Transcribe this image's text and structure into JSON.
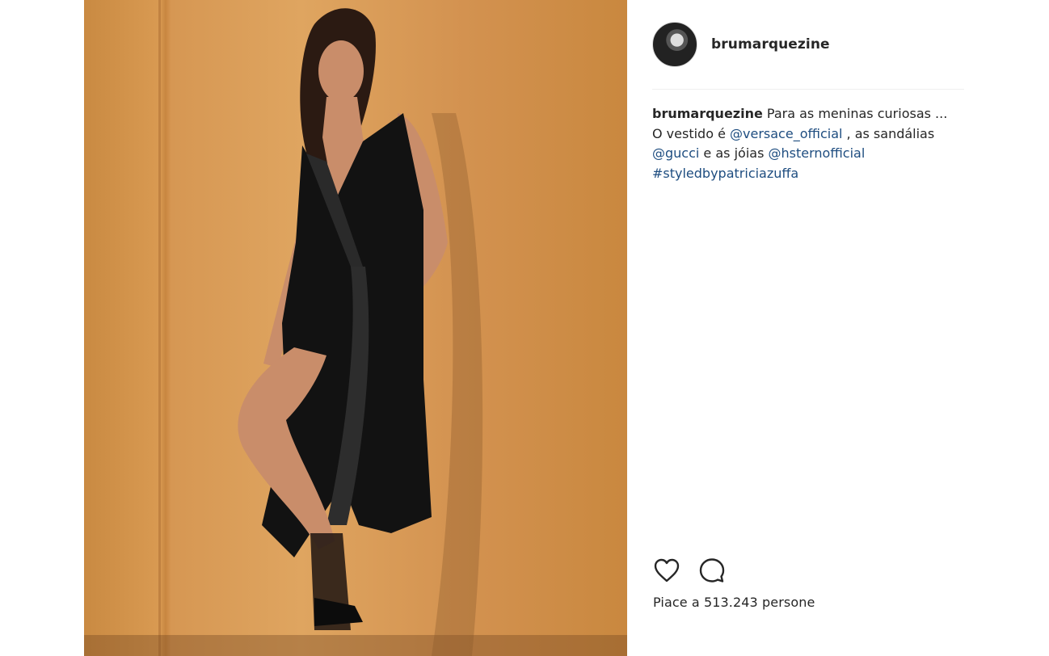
{
  "post": {
    "username": "brumarquezine",
    "caption": {
      "user": "brumarquezine",
      "line1_text": " Para as meninas curiosas ...",
      "line2_prefix": "O vestido é ",
      "line2_tag": "@versace_official",
      "line2_suffix": " , as sandálias",
      "line3_tag1": "@gucci",
      "line3_middle": " e as jóias ",
      "line3_tag2": "@hsternofficial",
      "line4_hashtag": "#styledbypatriciazuffa"
    },
    "likes_text": "Piace a 513.243 persone"
  },
  "icons": {
    "like": "heart-outline-icon",
    "comment": "speech-bubble-icon"
  },
  "colors": {
    "link": "#1e4d80",
    "text": "#262626",
    "wall": "#d99a52"
  }
}
